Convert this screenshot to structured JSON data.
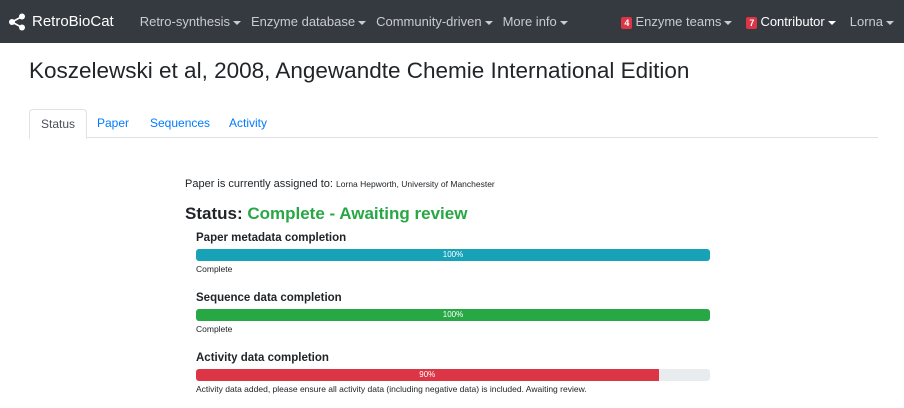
{
  "navbar": {
    "brand": "RetroBioCat",
    "menus": [
      "Retro-synthesis",
      "Enzyme database",
      "Community-driven",
      "More info"
    ],
    "enzyme_teams": {
      "badge": "4",
      "label": "Enzyme teams"
    },
    "contributor": {
      "badge": "7",
      "label": "Contributor"
    },
    "user": "Lorna"
  },
  "page_title": "Koszelewski et al, 2008, Angewandte Chemie International Edition",
  "tabs": [
    "Status",
    "Paper",
    "Sequences",
    "Activity"
  ],
  "assigned": {
    "prefix": "Paper is currently assigned to: ",
    "who": "Lorna Hepworth, University of Manchester"
  },
  "status": {
    "label": "Status: ",
    "value": "Complete - Awaiting review"
  },
  "progress": [
    {
      "label": "Paper metadata completion",
      "percent": 100,
      "text": "100%",
      "color": "#17a2b8",
      "note": "Complete"
    },
    {
      "label": "Sequence data completion",
      "percent": 100,
      "text": "100%",
      "color": "#28a745",
      "note": "Complete"
    },
    {
      "label": "Activity data completion",
      "percent": 90,
      "text": "90%",
      "color": "#dc3545",
      "note": "Activity data added, please ensure all activity data (including negative data) is included. Awaiting review."
    }
  ],
  "colors": {
    "navbar": "#343a40",
    "link": "#007bff",
    "success": "#28a745"
  }
}
